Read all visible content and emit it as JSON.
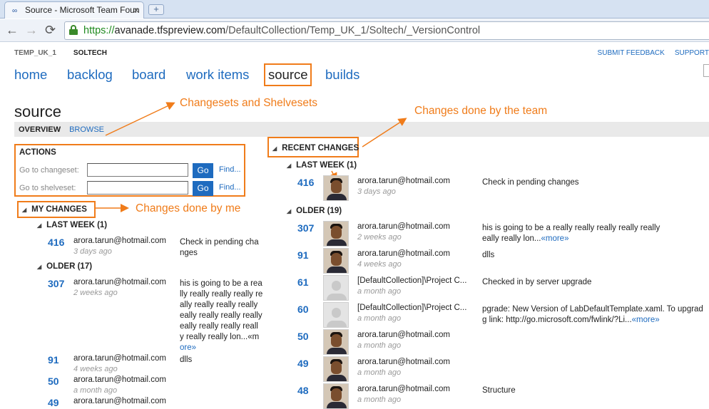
{
  "browser": {
    "tab_title": "Source - Microsoft Team Foun",
    "tab_close": "×",
    "new_tab": "+",
    "url_scheme": "https://",
    "url_host": "avanade.tfspreview.com",
    "url_path": "/DefaultCollection/Temp_UK_1/Soltech/_VersionControl"
  },
  "breadcrumb": {
    "project": "TEMP_UK_1",
    "team": "SOLTECH"
  },
  "top_links": {
    "feedback": "SUBMIT FEEDBACK",
    "support": "SUPPORT"
  },
  "nav": {
    "home": "home",
    "backlog": "backlog",
    "board": "board",
    "work_items": "work items",
    "source": "source",
    "builds": "builds"
  },
  "page": {
    "title": "source",
    "overview": "OVERVIEW",
    "browse": "BROWSE"
  },
  "callouts": {
    "shelvesets": "Changesets and Shelvesets",
    "team": "Changes done by the team",
    "me": "Changes done by me"
  },
  "actions": {
    "header": "ACTIONS",
    "changeset_label": "Go to changeset:",
    "shelveset_label": "Go to shelveset:",
    "go": "Go",
    "find": "Find..."
  },
  "my_changes": {
    "header": "MY CHANGES",
    "last_week_header": "LAST WEEK (1)",
    "older_header": "OLDER (17)",
    "items": [
      {
        "id": "416",
        "author": "arora.tarun@hotmail.com",
        "when": "3 days ago",
        "comment_lines": [
          "Check in pending cha",
          "nges"
        ],
        "more": ""
      },
      {
        "id": "307",
        "author": "arora.tarun@hotmail.com",
        "when": "2 weeks ago",
        "comment_lines": [
          "his is going to be a rea",
          "lly really really really re",
          "ally really really really",
          "eally really really really",
          "eally really really reall",
          "y really really lon...«m"
        ],
        "more": "ore»"
      },
      {
        "id": "91",
        "author": "arora.tarun@hotmail.com",
        "when": "4 weeks ago",
        "comment_lines": [
          "dlls"
        ],
        "more": ""
      },
      {
        "id": "50",
        "author": "arora.tarun@hotmail.com",
        "when": "a month ago",
        "comment_lines": [],
        "more": ""
      },
      {
        "id": "49",
        "author": "arora.tarun@hotmail.com",
        "when": "",
        "comment_lines": [],
        "more": ""
      }
    ]
  },
  "recent_changes": {
    "header": "RECENT CHANGES",
    "last_week_header": "LAST WEEK (1)",
    "older_header": "OLDER (19)",
    "items": [
      {
        "id": "416",
        "author": "arora.tarun@hotmail.com",
        "when": "3 days ago",
        "comment_lines": [
          "Check in pending changes"
        ],
        "more": "",
        "avatar": "photo"
      },
      {
        "id": "307",
        "author": "arora.tarun@hotmail.com",
        "when": "2 weeks ago",
        "comment_lines": [
          "his is going to be a really really really really really",
          "eally really lon..."
        ],
        "more": "«more»",
        "avatar": "photo"
      },
      {
        "id": "91",
        "author": "arora.tarun@hotmail.com",
        "when": "4 weeks ago",
        "comment_lines": [
          "dlls"
        ],
        "more": "",
        "avatar": "photo"
      },
      {
        "id": "61",
        "author": "[DefaultCollection]\\Project C...",
        "when": "a month ago",
        "comment_lines": [
          "Checked in by server upgrade"
        ],
        "more": "",
        "avatar": "blank"
      },
      {
        "id": "60",
        "author": "[DefaultCollection]\\Project C...",
        "when": "a month ago",
        "comment_lines": [
          "pgrade: New Version of LabDefaultTemplate.xaml. To upgrad",
          "g link: http://go.microsoft.com/fwlink/?Li..."
        ],
        "more": "«more»",
        "avatar": "blank"
      },
      {
        "id": "50",
        "author": "arora.tarun@hotmail.com",
        "when": "a month ago",
        "comment_lines": [],
        "more": "",
        "avatar": "photo"
      },
      {
        "id": "49",
        "author": "arora.tarun@hotmail.com",
        "when": "a month ago",
        "comment_lines": [],
        "more": "",
        "avatar": "photo"
      },
      {
        "id": "48",
        "author": "arora.tarun@hotmail.com",
        "when": "a month ago",
        "comment_lines": [
          "Structure"
        ],
        "more": "",
        "avatar": "photo"
      }
    ]
  }
}
